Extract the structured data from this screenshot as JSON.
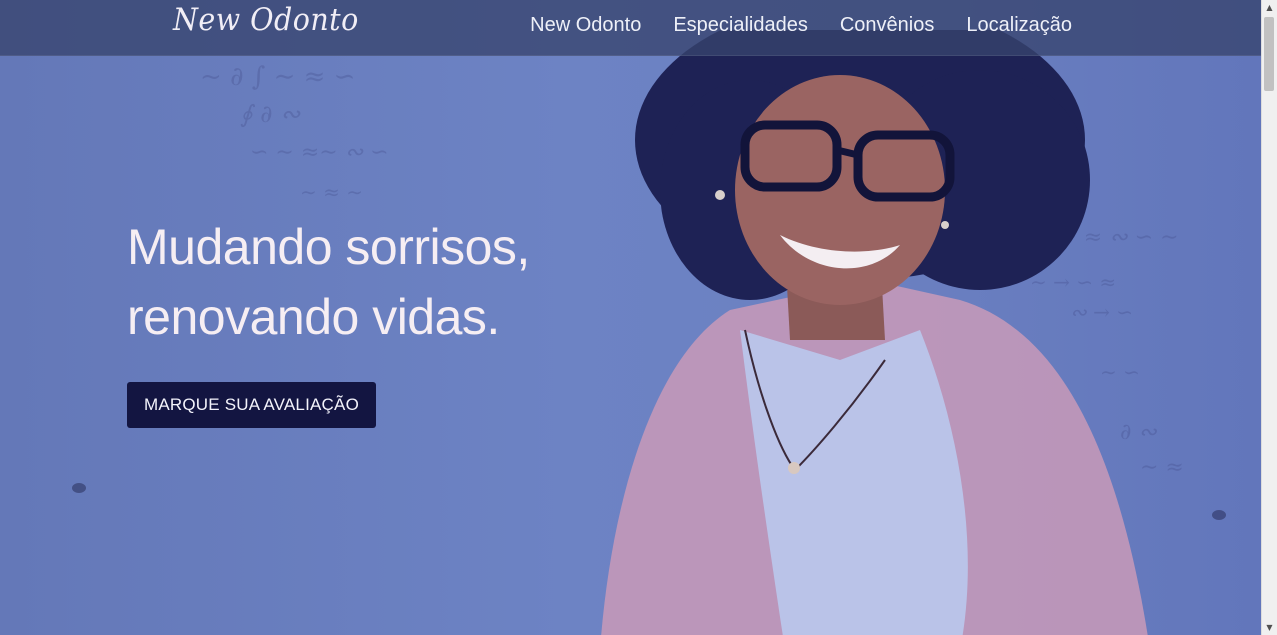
{
  "navbar": {
    "logo": "New Odonto",
    "links": [
      {
        "label": "New Odonto"
      },
      {
        "label": "Especialidades"
      },
      {
        "label": "Convênios"
      },
      {
        "label": "Localização"
      }
    ]
  },
  "hero": {
    "title_line1": "Mudando sorrisos,",
    "title_line2": "renovando vidas.",
    "cta_label": "MARQUE SUA AVALIAÇÃO"
  },
  "colors": {
    "overlay": "#6a7fc0",
    "navbar": "#37446e",
    "cta_background": "#131541",
    "hero_text": "#f6eef3"
  },
  "scrollbar": {
    "up_icon": "triangle-up-icon",
    "down_icon": "triangle-down-icon"
  }
}
